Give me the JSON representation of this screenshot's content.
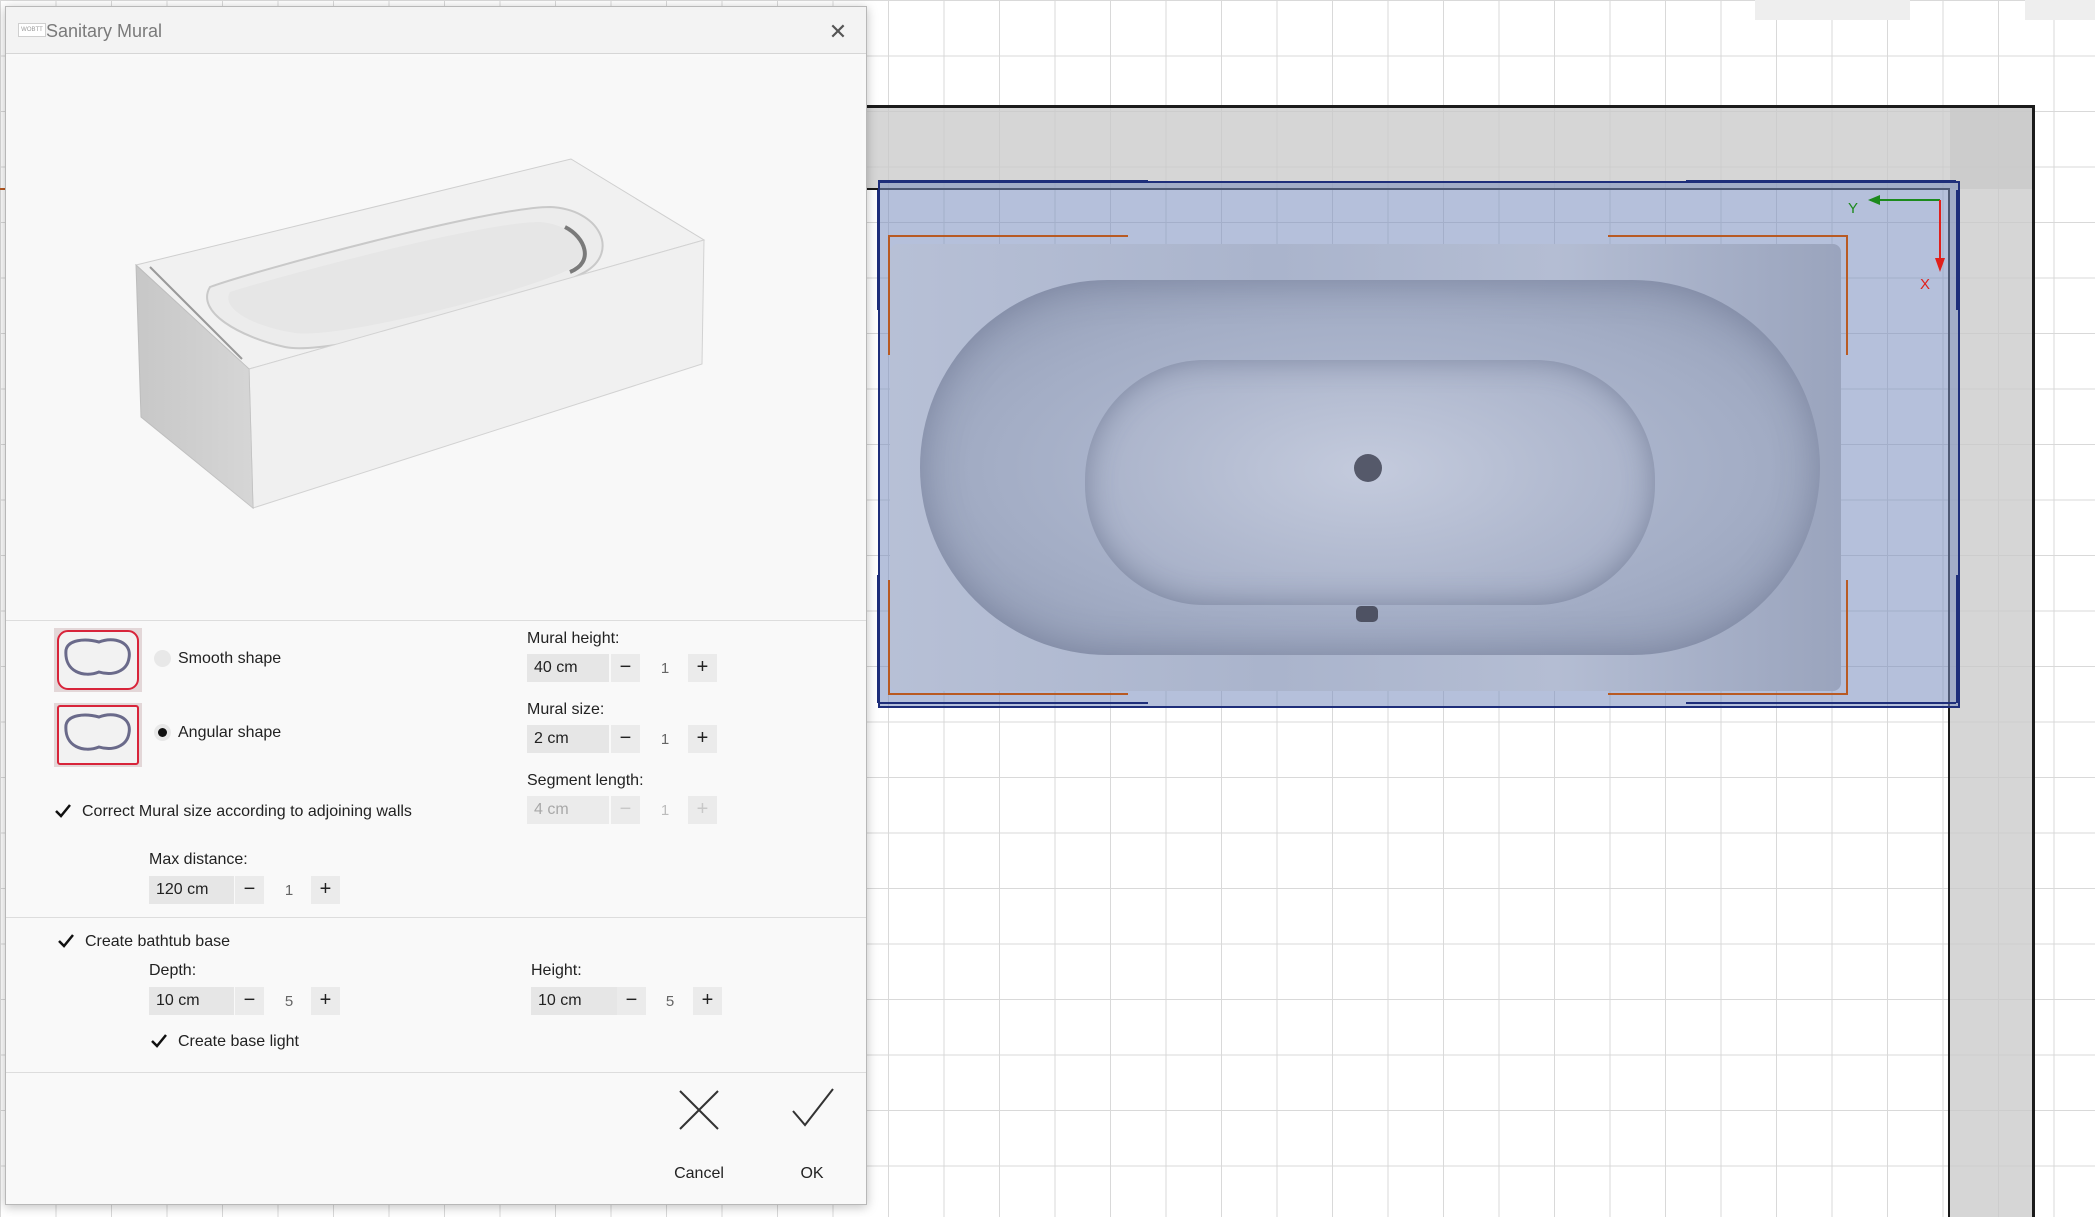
{
  "dialog": {
    "title": "Sanitary Mural",
    "app_icon_text": "WOBTT",
    "close_icon": "close-icon"
  },
  "shape": {
    "smooth_label": "Smooth shape",
    "angular_label": "Angular shape",
    "selected": "angular"
  },
  "mural_height": {
    "label": "Mural height:",
    "value": "40 cm",
    "step": "1",
    "minus": "−",
    "plus": "+"
  },
  "mural_size": {
    "label": "Mural size:",
    "value": "2 cm",
    "step": "1",
    "minus": "−",
    "plus": "+"
  },
  "segment_length": {
    "label": "Segment length:",
    "value": "4 cm",
    "step": "1",
    "minus": "−",
    "plus": "+",
    "disabled": true
  },
  "correct_size": {
    "label": "Correct Mural size according to adjoining walls",
    "checked": true
  },
  "max_distance": {
    "label": "Max distance:",
    "value": "120 cm",
    "step": "1",
    "minus": "−",
    "plus": "+"
  },
  "bathtub_base": {
    "label": "Create bathtub base",
    "checked": true
  },
  "depth": {
    "label": "Depth:",
    "value": "10 cm",
    "step": "5",
    "minus": "−",
    "plus": "+"
  },
  "height": {
    "label": "Height:",
    "value": "10 cm",
    "step": "5",
    "minus": "−",
    "plus": "+"
  },
  "base_light": {
    "label": "Create base light",
    "checked": true
  },
  "footer": {
    "cancel_label": "Cancel",
    "ok_label": "OK"
  },
  "canvas": {
    "axis_x_label": "X",
    "axis_y_label": "Y",
    "colors": {
      "selection": "#1e2e7a",
      "axis_x": "#e0201c",
      "axis_y": "#1c8a1c",
      "orange_guides": "#b85a23"
    }
  }
}
